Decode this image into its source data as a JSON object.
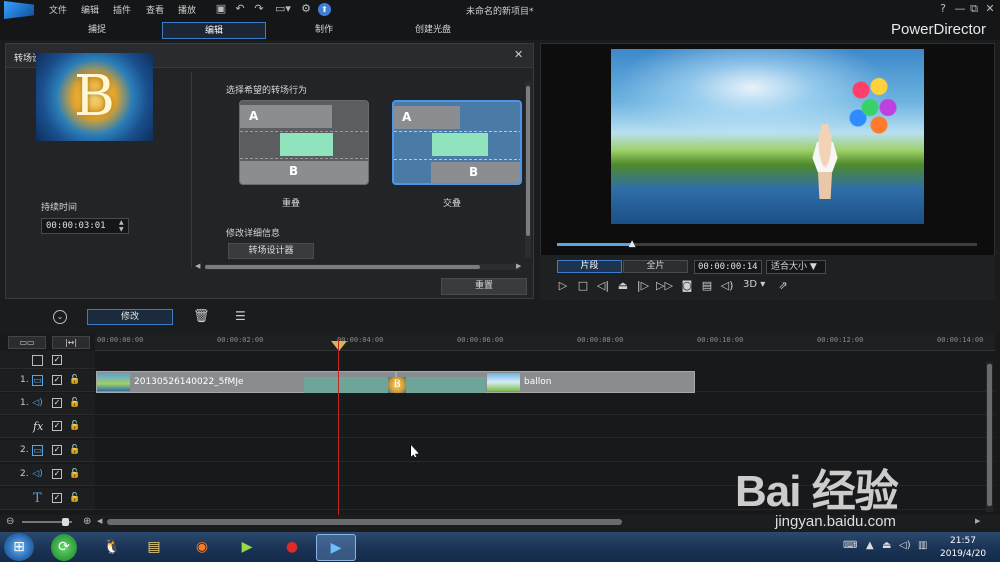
{
  "app": {
    "title": "未命名的新项目*",
    "brand": "PowerDirector",
    "menus": [
      "文件",
      "编辑",
      "插件",
      "查看",
      "播放"
    ],
    "tabs": [
      "捕捉",
      "编辑",
      "制作",
      "创建光盘"
    ],
    "active_tab": "编辑",
    "window_controls": [
      "?",
      "—",
      "⧉",
      "✕"
    ]
  },
  "transition_panel": {
    "title": "转场设置",
    "close": "✕",
    "duration_label": "持续时间",
    "duration_value": "00:00:03:01",
    "behavior_label": "选择希望的转场行为",
    "options": [
      {
        "name": "重叠",
        "a": "A",
        "b": "B",
        "selected": false
      },
      {
        "name": "交叠",
        "a": "A",
        "b": "B",
        "selected": true
      }
    ],
    "modify_label": "修改详细信息",
    "designer_button": "转场设计器",
    "reset_button": "重置"
  },
  "preview": {
    "clip_tab": "片段",
    "full_tab": "全片",
    "timecode": "00:00:00:14",
    "fit": "适合大小 ▼",
    "mode_3d": "3D ▾",
    "progress": 0.18
  },
  "edit_toolbar": {
    "modify_button": "修改"
  },
  "timeline": {
    "ruler_ticks": [
      "00:00:00:00",
      "00:00:02:00",
      "00:00:04:00",
      "00:00:06:00",
      "00:00:08:00",
      "00:00:10:00",
      "00:00:12:00",
      "00:00:14:00"
    ],
    "tracks": [
      {
        "num": "1.",
        "type": "video"
      },
      {
        "num": "1.",
        "type": "audio"
      },
      {
        "num": "",
        "type": "fx"
      },
      {
        "num": "2.",
        "type": "video"
      },
      {
        "num": "2.",
        "type": "audio"
      },
      {
        "num": "",
        "type": "title"
      }
    ],
    "clips": [
      {
        "name": "20130526140022_5fMJe"
      },
      {
        "name": "ballon"
      }
    ]
  },
  "taskbar": {
    "time": "21:57",
    "date": "2019/4/20"
  },
  "watermark": {
    "text": "Bai 经验",
    "url": "jingyan.baidu.com"
  },
  "colors": {
    "accent": "#3d7cc9",
    "clip": "#8a8d90",
    "transition": "#6aa89b",
    "playhead": "#c02626"
  }
}
